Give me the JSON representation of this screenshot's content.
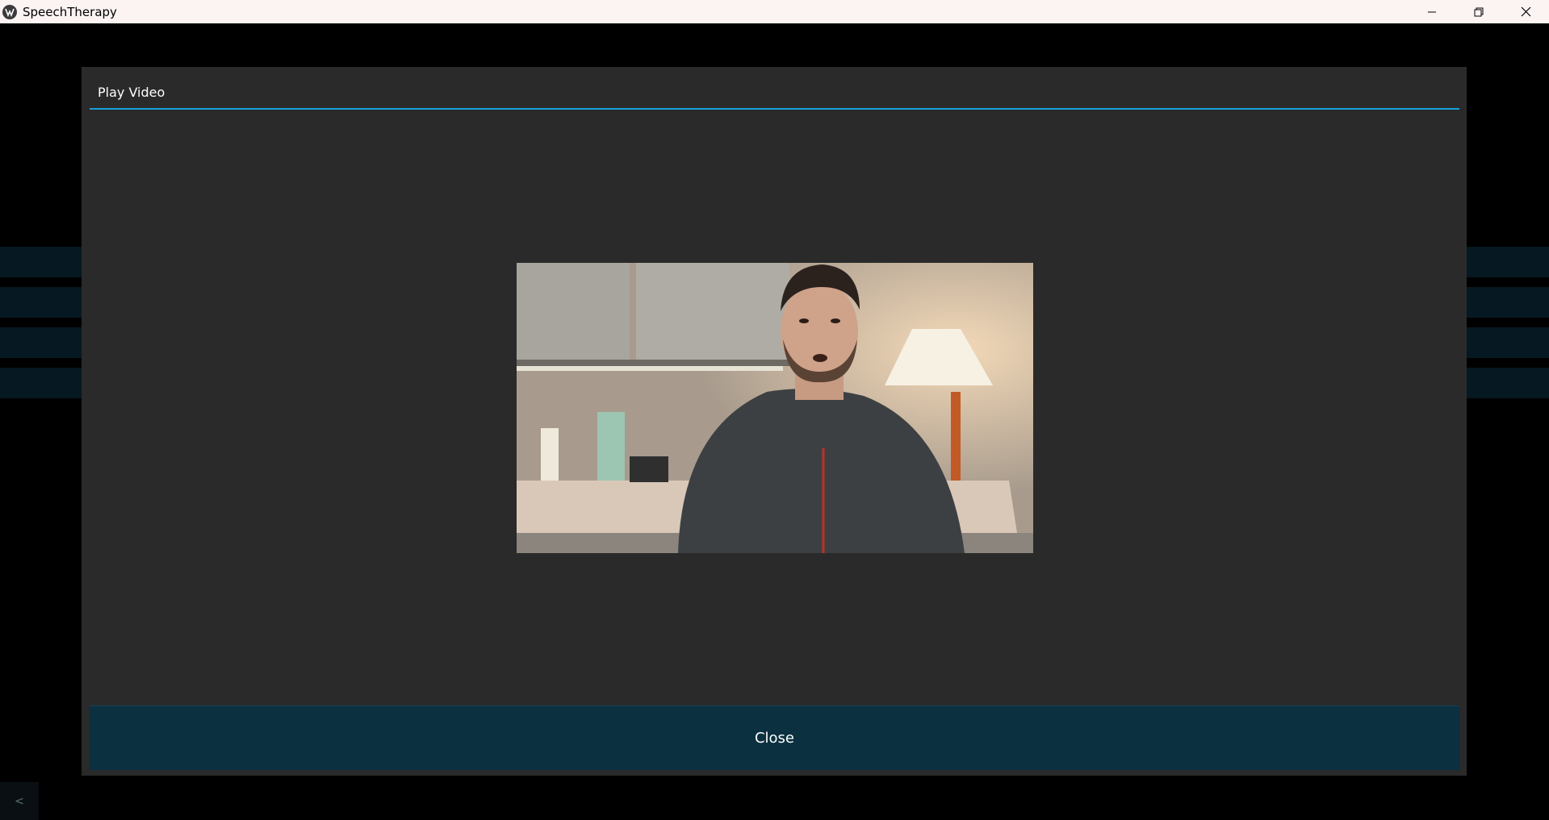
{
  "window": {
    "title": "SpeechTherapy",
    "minimize_icon": "minimize-icon",
    "restore_icon": "restore-icon",
    "close_icon": "close-icon"
  },
  "dialog": {
    "title": "Play Video",
    "close_label": "Close",
    "accent_color": "#1aa0d8"
  },
  "background": {
    "back_label": "<"
  }
}
